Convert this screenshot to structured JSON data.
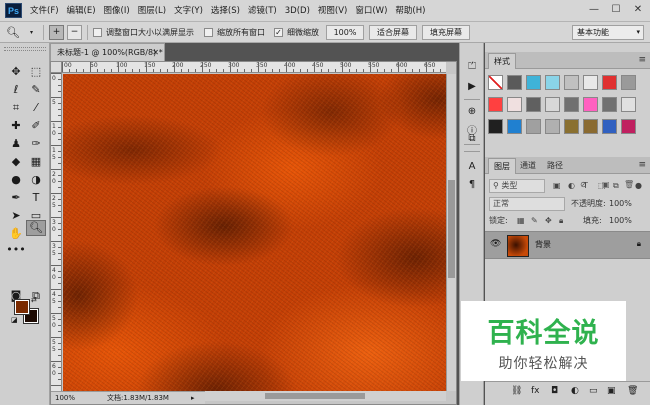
{
  "app": {
    "logo": "Ps"
  },
  "menu": [
    "文件(F)",
    "编辑(E)",
    "图像(I)",
    "图层(L)",
    "文字(Y)",
    "选择(S)",
    "滤镜(T)",
    "3D(D)",
    "视图(V)",
    "窗口(W)",
    "帮助(H)"
  ],
  "window_controls": {
    "minimize": "—",
    "maximize": "☐",
    "close": "✕"
  },
  "options": {
    "tool_icon": "zoom-icon",
    "resize_windows_label": "调整窗口大小以满屏显示",
    "zoom_all_label": "缩放所有窗口",
    "scrubby_zoom_label": "细微缩放",
    "scrubby_zoom_checked": true,
    "zoom_100": "100%",
    "fit_screen": "适合屏幕",
    "fill_screen": "填充屏幕",
    "workspace": "基本功能"
  },
  "document": {
    "tab_title": "未标题-1 @ 100%(RGB/8) *",
    "status_zoom": "100%",
    "status_doc": "文档:1.83M/1.83M",
    "ruler_h": [
      "00",
      "50",
      "100",
      "150",
      "200",
      "250",
      "300",
      "350",
      "400",
      "450",
      "500",
      "550",
      "600",
      "650"
    ],
    "ruler_v": [
      "0",
      "5",
      "1 0",
      "1 5",
      "2 0",
      "2 5",
      "3 0",
      "3 5",
      "4 0",
      "4 5",
      "5 0",
      "5 5",
      "6 0"
    ]
  },
  "colors": {
    "foreground": "#7a2a00",
    "background": "#1d0a02",
    "canvas_base": "#c43f06"
  },
  "styles_panel": {
    "tab": "样式",
    "swatches": [
      "#f4f4f4",
      "#5a5a5a",
      "#3fb3d8",
      "#8ad4e8",
      "#c0c0c0",
      "#e8e8e8",
      "#e03030",
      "#9a9a9a",
      "#ff4040",
      "#f0e0e0",
      "#606060",
      "#d8d8d8",
      "#707070",
      "#ff60c0",
      "#707070",
      "#e0e0e0",
      "#202020",
      "#2080d0",
      "#a0a0a0",
      "#b0b0b0",
      "#8a7030",
      "#8a6a30",
      "#3060c0",
      "#c02060"
    ]
  },
  "layers_panel": {
    "tabs": [
      "图层",
      "通道",
      "路径"
    ],
    "filter_kind": "类型",
    "blend_mode": "正常",
    "opacity_label": "不透明度:",
    "opacity_value": "100%",
    "lock_label": "锁定:",
    "fill_label": "填充:",
    "fill_value": "100%",
    "layer_name": "背景"
  },
  "watermark": {
    "title": "百科全说",
    "subtitle": "助你轻松解决"
  }
}
